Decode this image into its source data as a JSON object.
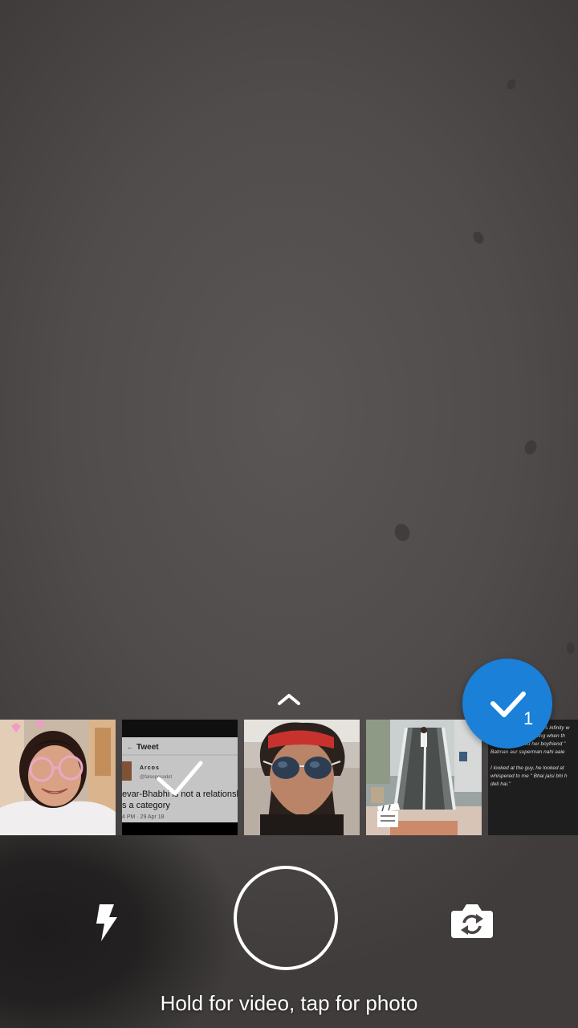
{
  "camera": {
    "hint": "Hold for video, tap for photo",
    "flash_icon": "flash-icon",
    "switch_icon": "switch-camera-icon",
    "expand_icon": "chevron-up-icon"
  },
  "gallery": {
    "selected_count": "1",
    "thumbnails": [
      {
        "kind": "photo",
        "desc": "selfie"
      },
      {
        "kind": "screenshot",
        "selected": true,
        "header": "Tweet",
        "account_name": "Arcos",
        "handle": "@falsepocodot",
        "line1": "evar-Bhabhi is not a relationshi",
        "line2": "s a category",
        "footer": "4 PM · 29 Apr 18"
      },
      {
        "kind": "photo",
        "desc": "portrait"
      },
      {
        "kind": "video",
        "desc": "escalator"
      },
      {
        "kind": "screenshot",
        "lines": [
          "I was watching Avengers infinity w",
          "it was nearly the ending when th",
          "behind me asked her boyfriend \"",
          "Batman aur superman nahi aaie",
          "",
          "I looked at the guy, he looked at",
          "whispered to me \" Bhai jaisi bhi h",
          "deti hai.\""
        ]
      }
    ]
  },
  "colors": {
    "accent": "#1a80d8",
    "background": "#504c4c"
  }
}
